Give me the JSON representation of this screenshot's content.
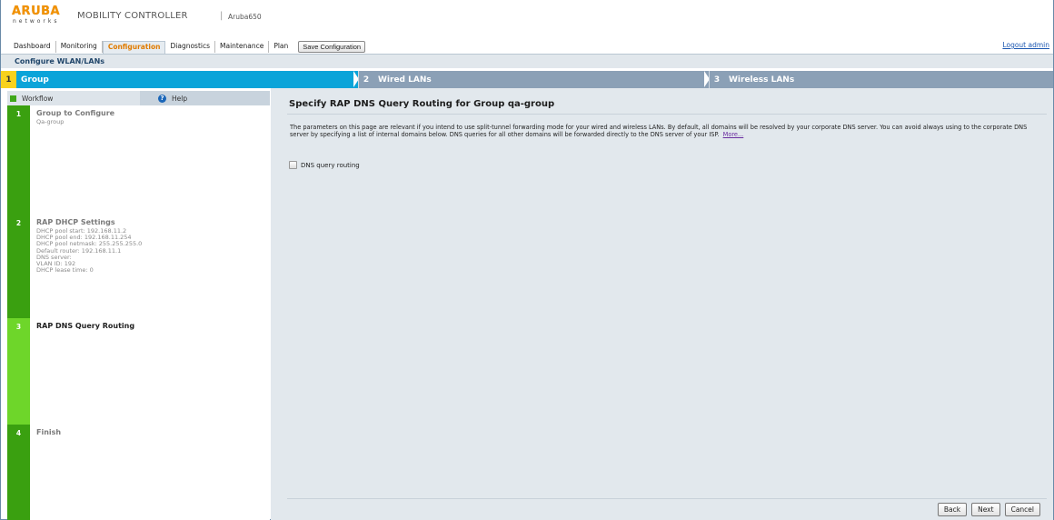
{
  "header": {
    "logo_text": "ARUBA",
    "logo_sub": "networks",
    "product_title": "MOBILITY CONTROLLER",
    "separator": "|",
    "device_name": "Aruba650"
  },
  "nav": {
    "tabs": [
      {
        "label": "Dashboard",
        "active": false
      },
      {
        "label": "Monitoring",
        "active": false
      },
      {
        "label": "Configuration",
        "active": true
      },
      {
        "label": "Diagnostics",
        "active": false
      },
      {
        "label": "Maintenance",
        "active": false
      },
      {
        "label": "Plan",
        "active": false
      }
    ],
    "save_label": "Save Configuration",
    "logout_label": "Logout admin"
  },
  "page": {
    "title": "Configure WLAN/LANs"
  },
  "steps": [
    {
      "num": "1",
      "label": "Group",
      "active": true
    },
    {
      "num": "2",
      "label": "Wired LANs",
      "active": false
    },
    {
      "num": "3",
      "label": "Wireless LANs",
      "active": false
    }
  ],
  "sidebar": {
    "workflow_tab": "Workflow",
    "help_tab": "Help",
    "items": [
      {
        "num": "1",
        "title": "Group to Configure",
        "details": [
          "Qa-group"
        ]
      },
      {
        "num": "2",
        "title": "RAP DHCP Settings",
        "details": [
          "DHCP pool start: 192.168.11.2",
          "DHCP pool end: 192.168.11.254",
          "DHCP pool netmask: 255.255.255.0",
          "Default router: 192.168.11.1",
          "DNS server:",
          "VLAN ID: 192",
          "DHCP lease time: 0"
        ]
      },
      {
        "num": "3",
        "title": "RAP DNS Query Routing",
        "details": []
      },
      {
        "num": "4",
        "title": "Finish",
        "details": []
      }
    ]
  },
  "main": {
    "title": "Specify RAP DNS Query Routing for Group qa-group",
    "description": "The parameters on this page are relevant if you intend to use split-tunnel forwarding mode for your wired and wireless LANs. By default, all domains will be resolved by your corporate DNS server. You can avoid always using to the corporate DNS server by specifying a list of internal domains below. DNS queries for all other domains will be forwarded directly to the DNS server of your ISP.",
    "more_link": "More...",
    "dns_checkbox_label": "DNS query routing",
    "dns_checked": false,
    "buttons": {
      "back": "Back",
      "next": "Next",
      "cancel": "Cancel"
    }
  },
  "colors": {
    "brand_orange": "#f39200",
    "step_active": "#0aa4d9",
    "step_inactive": "#8ba0b6",
    "step_num_active": "#f8d21d",
    "workflow_green": "#3aa010",
    "workflow_green_current": "#6ed62a",
    "content_bg": "#e2e8ed"
  }
}
